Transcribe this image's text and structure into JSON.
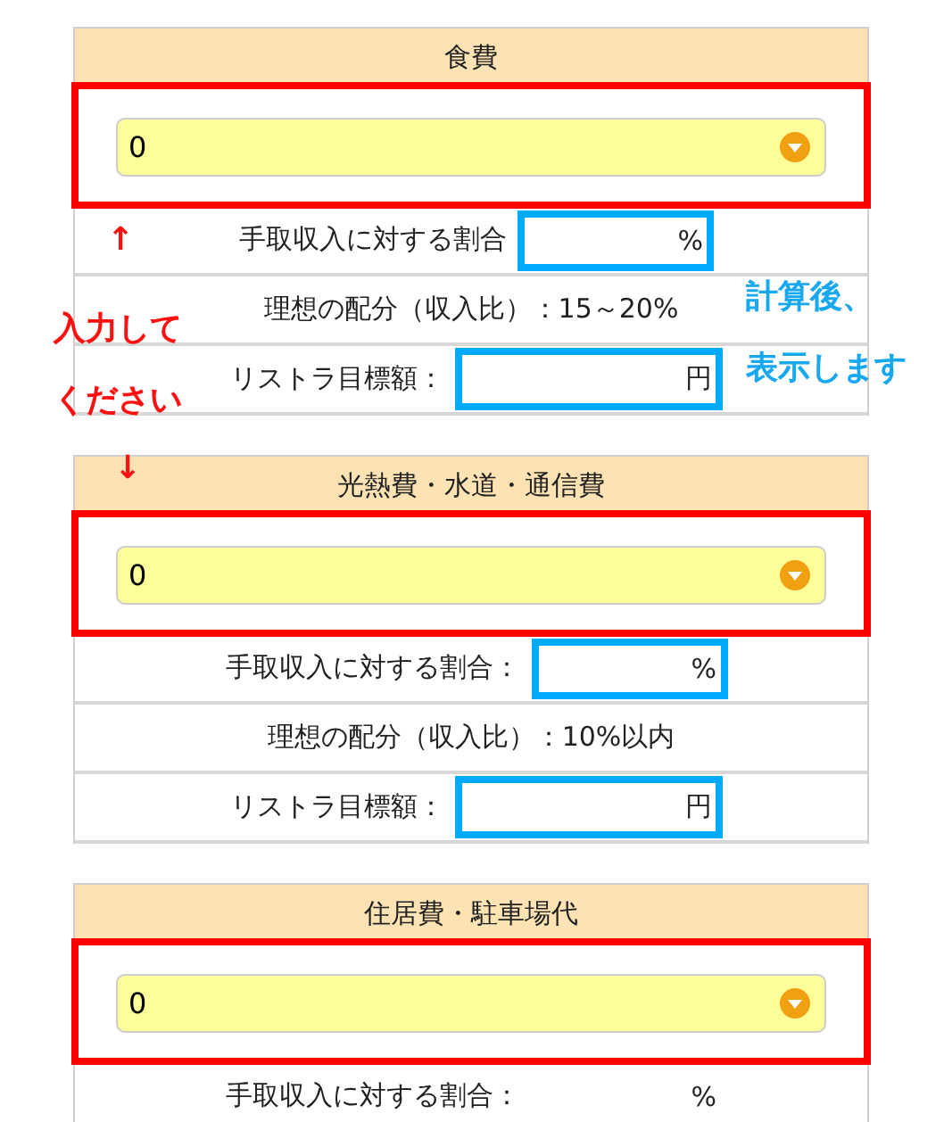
{
  "panels": [
    {
      "title": "食費",
      "select": {
        "value": "0",
        "highlighted": true
      },
      "rows": [
        {
          "kind": "ratio",
          "label": "手取収入に対する割合",
          "value": "%",
          "highlighted": true
        },
        {
          "kind": "ideal",
          "label": "理想の配分（収入比）：15～20%"
        },
        {
          "kind": "target",
          "label": "リストラ目標額：",
          "value": "円",
          "highlighted": true
        }
      ]
    },
    {
      "title": "光熱費・水道・通信費",
      "select": {
        "value": "0",
        "highlighted": true
      },
      "rows": [
        {
          "kind": "ratio",
          "label": "手取収入に対する割合：",
          "value": "%",
          "highlighted": true
        },
        {
          "kind": "ideal",
          "label": "理想の配分（収入比）：10%以内"
        },
        {
          "kind": "target",
          "label": "リストラ目標額：",
          "value": "円",
          "highlighted": true
        }
      ]
    },
    {
      "title": "住居費・駐車場代",
      "select": {
        "value": "0",
        "highlighted": true
      },
      "rows": [
        {
          "kind": "ratio",
          "label": "手取収入に対する割合：",
          "value": "%",
          "highlighted": false
        }
      ]
    }
  ],
  "input_note": {
    "arrows": [
      "↑",
      "↓"
    ],
    "lines": [
      "入力して",
      "ください"
    ]
  },
  "output_note": {
    "lines": [
      "計算後、",
      "表示します"
    ]
  }
}
